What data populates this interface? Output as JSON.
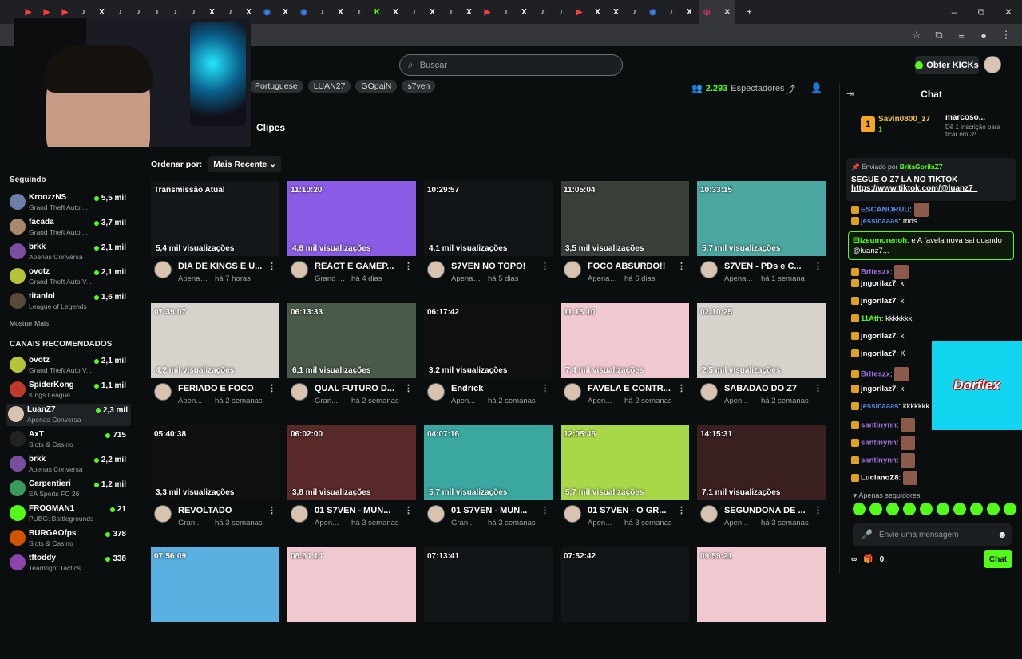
{
  "browser": {
    "tab_icons": [
      "▶",
      "▶",
      "▶",
      "♪",
      "X",
      "♪",
      "♪",
      "♪",
      "♪",
      "♪",
      "X",
      "♪",
      "X",
      "◉",
      "X",
      "◉",
      "♪",
      "X",
      "♪",
      "K",
      "X",
      "♪",
      "X",
      "♪",
      "X",
      "▶",
      "♪",
      "X",
      "♪",
      "♪",
      "▶",
      "X",
      "X",
      "♪",
      "◉",
      "♪",
      "X",
      "◎"
    ],
    "tab_colors": [
      "#ff3b3b",
      "#ff3b3b",
      "#ff3b3b",
      "#ffffff",
      "#ffffff",
      "#ffffff",
      "#ffffff",
      "#ffffff",
      "#ffffff",
      "#ffffff",
      "#ffffff",
      "#ffffff",
      "#ffffff",
      "#3b82f6",
      "#ffffff",
      "#3b82f6",
      "#ffffff",
      "#ffffff",
      "#ffffff",
      "#53fc18",
      "#ffffff",
      "#ffffff",
      "#ffffff",
      "#ffffff",
      "#ffffff",
      "#ff3b3b",
      "#ffffff",
      "#ffffff",
      "#ffffff",
      "#ffffff",
      "#ff3b3b",
      "#ffffff",
      "#ffffff",
      "#ffffff",
      "#3b82f6",
      "#ffffff",
      "#ffffff",
      "#e1306c"
    ],
    "active_tab_close": "✕",
    "new_tab": "+",
    "window_controls": [
      "–",
      "⧉",
      "✕"
    ]
  },
  "header": {
    "search_placeholder": "Buscar",
    "get_kicks": "Obter KICKs"
  },
  "channel": {
    "tags": [
      "Portuguese",
      "LUAN27",
      "GOpaiN",
      "s7ven"
    ],
    "viewers_count": "2.293",
    "viewers_label": "Espectadores",
    "clips_tab": "Clipes"
  },
  "sidebar": {
    "following_header": "Seguindo",
    "following": [
      {
        "name": "KroozzNS",
        "category": "Grand Theft Auto ...",
        "viewers": "5,5 mil",
        "color": "#6b7fa8"
      },
      {
        "name": "facada",
        "category": "Grand Theft Auto ...",
        "viewers": "3,7 mil",
        "color": "#a88a6b"
      },
      {
        "name": "brkk",
        "category": "Apenas Conversa",
        "viewers": "2,1 mil",
        "color": "#7a4fa0"
      },
      {
        "name": "ovotz",
        "category": "Grand Theft Auto V...",
        "viewers": "2,1 mil",
        "color": "#b7c43a"
      },
      {
        "name": "titanlol",
        "category": "League of Legends",
        "viewers": "1,6 mil",
        "color": "#5a4a3a"
      }
    ],
    "show_more": "Mostrar Mais",
    "recommended_header": "CANAIS RECOMENDADOS",
    "recommended": [
      {
        "name": "ovotz",
        "category": "Grand Theft Auto V...",
        "viewers": "2,1 mil",
        "color": "#b7c43a"
      },
      {
        "name": "SpiderKong",
        "category": "Kings League",
        "viewers": "1,1 mil",
        "color": "#c0392b"
      },
      {
        "name": "LuanZ7",
        "category": "Apenas Conversa",
        "viewers": "2,3 mil",
        "color": "#d8c3b0"
      },
      {
        "name": "AxT",
        "category": "Slots & Casino",
        "viewers": "715",
        "color": "#222"
      },
      {
        "name": "brkk",
        "category": "Apenas Conversa",
        "viewers": "2,2 mil",
        "color": "#7a4fa0"
      },
      {
        "name": "Carpentieri",
        "category": "EA Sports FC 26",
        "viewers": "1,2 mil",
        "color": "#3a9a5a"
      },
      {
        "name": "FROGMAN1",
        "category": "PUBG: Battlegrounds",
        "viewers": "21",
        "color": "#53fc18"
      },
      {
        "name": "BURGAOfps",
        "category": "Slots & Casino",
        "viewers": "378",
        "color": "#d35400"
      },
      {
        "name": "tftoddy",
        "category": "Teamfight Tactics",
        "viewers": "338",
        "color": "#8e44ad"
      }
    ]
  },
  "sort": {
    "label": "Ordenar por:",
    "value": "Mais Recente"
  },
  "clips": [
    {
      "duration": "Transmissão Atual",
      "views": "5,4 mil visualizações",
      "title": "DIA DE KINGS E U...",
      "category": "Apenas ...",
      "age": "há 7 horas",
      "bg": "#15181b"
    },
    {
      "duration": "11:10:20",
      "views": "4,6 mil visualizações",
      "title": "REACT E GAMEP...",
      "category": "Grand Th...",
      "age": "há 4 dias",
      "bg": "#8a5ce6"
    },
    {
      "duration": "10:29:57",
      "views": "4,1 mil visualizações",
      "title": "S7VEN NO TOPO!",
      "category": "Apenas C...",
      "age": "há 5 dias",
      "bg": "#121517"
    },
    {
      "duration": "11:05:04",
      "views": "3,5 mil visualizações",
      "title": "FOCO ABSURDO!!",
      "category": "Apenas C...",
      "age": "há 6 dias",
      "bg": "#3a3f3a"
    },
    {
      "duration": "10:33:15",
      "views": "5,7 mil visualizações",
      "title": "S7VEN - PDs e C...",
      "category": "Apena...",
      "age": "há 1 semana",
      "bg": "#4aa8a0"
    },
    {
      "duration": "07:39:07",
      "views": "4,2 mil visualizações",
      "title": "FERIADO E FOCO",
      "category": "Apen...",
      "age": "há 2 semanas",
      "bg": "#d8d2cc"
    },
    {
      "duration": "06:13:33",
      "views": "6,1 mil visualizações",
      "title": "QUAL FUTURO D...",
      "category": "Gran...",
      "age": "há 2 semanas",
      "bg": "#4a5a4a"
    },
    {
      "duration": "06:17:42",
      "views": "3,2 mil visualizações",
      "title": "Endrick",
      "category": "Apen...",
      "age": "há 2 semanas",
      "bg": "#0e1012"
    },
    {
      "duration": "11:15:10",
      "views": "7,4 mil visualizações",
      "title": "FAVELA E CONTR...",
      "category": "Apen...",
      "age": "há 2 semanas",
      "bg": "#f0c8d0"
    },
    {
      "duration": "02:10:25",
      "views": "2,5 mil visualizações",
      "title": "SABADAO DO Z7",
      "category": "Apen...",
      "age": "há 2 semanas",
      "bg": "#d8d2cc"
    },
    {
      "duration": "05:40:38",
      "views": "3,3 mil visualizações",
      "title": "REVOLTADO",
      "category": "Gran...",
      "age": "há 3 semanas",
      "bg": "#0e1012"
    },
    {
      "duration": "06:02:00",
      "views": "3,8 mil visualizações",
      "title": "01 S7VEN - MUN...",
      "category": "Apen...",
      "age": "há 3 semanas",
      "bg": "#5a2a2a"
    },
    {
      "duration": "04:07:16",
      "views": "5,7 mil visualizações",
      "title": "01 S7VEN - MUN...",
      "category": "Gran...",
      "age": "há 3 semanas",
      "bg": "#3aa8a0"
    },
    {
      "duration": "12:05:46",
      "views": "5,7 mil visualizações",
      "title": "01 S7VEN - O GR...",
      "category": "Apen...",
      "age": "há 3 semanas",
      "bg": "#a8d848"
    },
    {
      "duration": "14:15:31",
      "views": "7,1 mil visualizações",
      "title": "SEGUNDONA DE ...",
      "category": "Apen...",
      "age": "há 3 semanas",
      "bg": "#3a2020"
    },
    {
      "duration": "07:56:09",
      "views": "",
      "title": "",
      "category": "",
      "age": "",
      "bg": "#5ab0e0"
    },
    {
      "duration": "08:54:14",
      "views": "",
      "title": "",
      "category": "",
      "age": "",
      "bg": "#f0c8d0"
    },
    {
      "duration": "07:13:41",
      "views": "",
      "title": "",
      "category": "",
      "age": "",
      "bg": "#121517"
    },
    {
      "duration": "07:52:42",
      "views": "",
      "title": "",
      "category": "",
      "age": "",
      "bg": "#121517"
    },
    {
      "duration": "09:59:21",
      "views": "",
      "title": "",
      "category": "",
      "age": "",
      "bg": "#f0c8d0"
    }
  ],
  "chat": {
    "title": "Chat",
    "leader1_rank": "1",
    "leader1_name": "Savin0800_z7",
    "leader1_sub": "1",
    "leader2_name": "marcoso...",
    "leader2_sub": "1",
    "leader2_note": "Dê 1 inscrição para ficar em 3º",
    "pinned_by_label": "Enviado por",
    "pinned_by_user": "BritaGorilaZ7",
    "pinned_line1": "SEGUE O Z7 LA NO TIKTOK",
    "pinned_line2": "https://www.tiktok.com/@luanz7_",
    "highlight_user": "Elizeumorenoh",
    "highlight_text": ": e A favela nova sai quando @luanz7...",
    "messages": [
      {
        "user": "ESCANORUU",
        "text": ":",
        "color": "#5a8ae6"
      },
      {
        "user": "jessicaaas",
        "text": ": mds",
        "color": "#5a8ae6"
      },
      {
        "user": "Briteszx",
        "text": ":",
        "color": "#a070e0"
      },
      {
        "user": "jngorilaz7",
        "text": ": k",
        "color": "#ffffff"
      },
      {
        "user": "jngorilaz7",
        "text": ": k",
        "color": "#ffffff"
      },
      {
        "user": "11Ath",
        "text": ": kkkkkkk",
        "color": "#53fc18"
      },
      {
        "user": "jngorilaz7",
        "text": ": k",
        "color": "#ffffff"
      },
      {
        "user": "jngorilaz7",
        "text": ": K",
        "color": "#ffffff"
      },
      {
        "user": "Briteszx",
        "text": ":",
        "color": "#a070e0"
      },
      {
        "user": "jngorilaz7",
        "text": ": k",
        "color": "#ffffff"
      },
      {
        "user": "jessicaaas",
        "text": ": kkkkkkk",
        "color": "#5a8ae6"
      },
      {
        "user": "santinynn",
        "text": ":",
        "color": "#a070e0"
      },
      {
        "user": "santinynn",
        "text": ":",
        "color": "#a070e0"
      },
      {
        "user": "santinynn",
        "text": ":",
        "color": "#a070e0"
      },
      {
        "user": "LucianoZ8",
        "text": ":",
        "color": "#ffffff"
      }
    ],
    "followers_only": "Apenas seguidores",
    "input_placeholder": "Envie uma mensagem",
    "kicks_count": "0",
    "chat_button": "Chat"
  },
  "ad": {
    "brand": "Dorflex"
  }
}
